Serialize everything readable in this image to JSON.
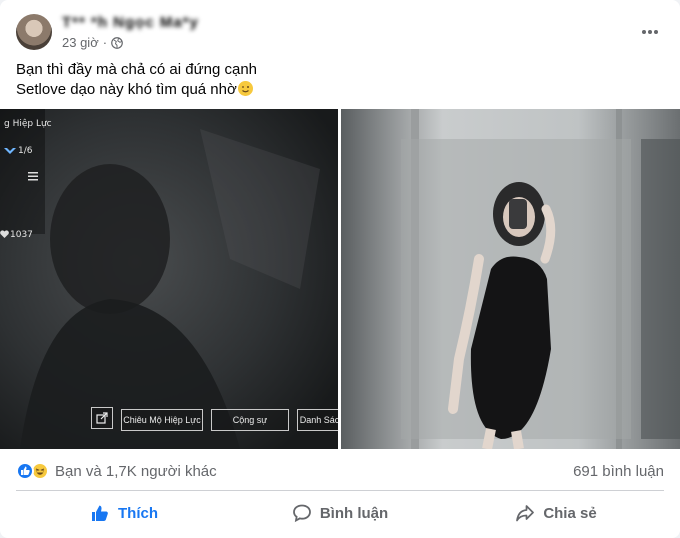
{
  "post": {
    "author_name": "T** *h Ngọc Ma*y",
    "time": "23 giờ",
    "privacy_icon": "globe-icon",
    "more_icon": "more-horizontal-icon",
    "caption_line1": "Bạn thì đầy mà chả có ai đứng cạnh",
    "caption_line2": "Setlove dạo này khó tìm quá nhờ",
    "caption_emoji": "😉"
  },
  "game_overlay": {
    "title": "g Hiệp Lực",
    "slots": "1/6",
    "likes": "1037",
    "buttons": [
      "Chiêu Mộ Hiệp Lực",
      "Cộng sự",
      "Danh Sác"
    ]
  },
  "reactions": {
    "icons": [
      "like-icon",
      "haha-icon"
    ],
    "summary": "Bạn và 1,7K người khác",
    "comments": "691 bình luận"
  },
  "actions": {
    "like": "Thích",
    "comment": "Bình luận",
    "share": "Chia sẻ"
  },
  "colors": {
    "accent": "#1877f2",
    "secondary_text": "#65676b",
    "divider": "#ced0d4"
  }
}
